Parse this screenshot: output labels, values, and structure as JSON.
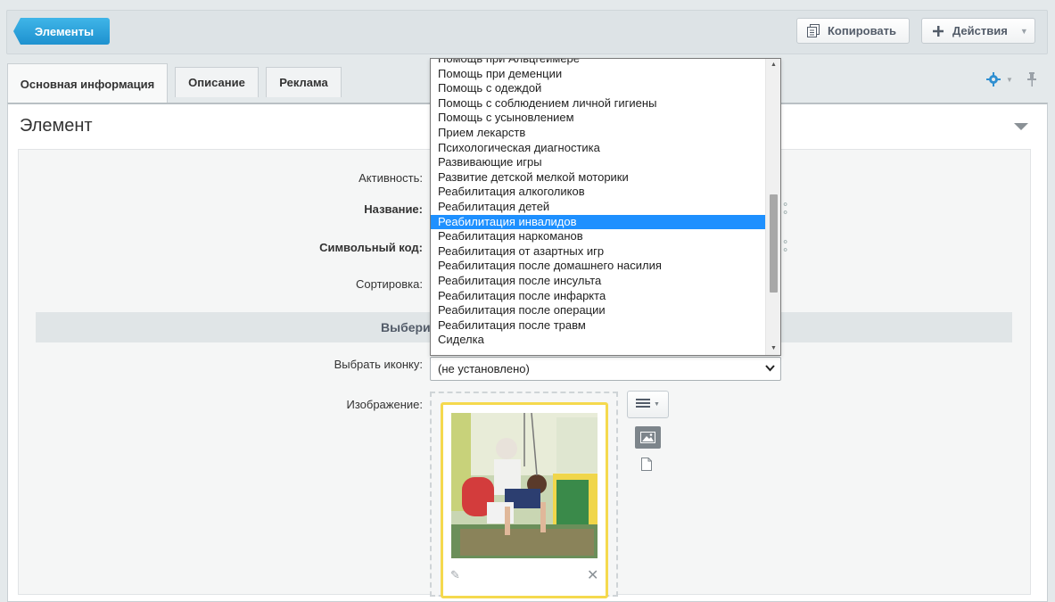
{
  "toolbar": {
    "back_label": "Элементы",
    "copy_label": "Копировать",
    "actions_label": "Действия"
  },
  "tabs": [
    {
      "label": "Основная информация",
      "active": true
    },
    {
      "label": "Описание",
      "active": false
    },
    {
      "label": "Реклама",
      "active": false
    }
  ],
  "section": {
    "title": "Элемент",
    "group_header": "Выбери"
  },
  "form": {
    "active_label": "Активность:",
    "name_label": "Название:",
    "code_label": "Символьный код:",
    "sort_label": "Сортировка:",
    "icon_label": "Выбрать иконку:",
    "image_label": "Изображение:",
    "icon_select_value": "(не установлено)"
  },
  "dropdown": {
    "items": [
      "Помощь при Альцгеймере",
      "Помощь при деменции",
      "Помощь с одеждой",
      "Помощь с соблюдением личной гигиены",
      "Помощь с усыновлением",
      "Прием лекарств",
      "Психологическая диагностика",
      "Развивающие игры",
      "Развитие детской мелкой моторики",
      "Реабилитация алкоголиков",
      "Реабилитация детей",
      "Реабилитация инвалидов",
      "Реабилитация наркоманов",
      "Реабилитация от азартных игр",
      "Реабилитация после домашнего насилия",
      "Реабилитация после инсульта",
      "Реабилитация после инфаркта",
      "Реабилитация после операции",
      "Реабилитация после травм",
      "Сиделка"
    ],
    "selected": "Реабилитация инвалидов"
  },
  "colors": {
    "accent": "#1e91cf",
    "selection": "#1e90ff",
    "image_frame": "#f5d94e",
    "gear": "#2f8fd1"
  }
}
